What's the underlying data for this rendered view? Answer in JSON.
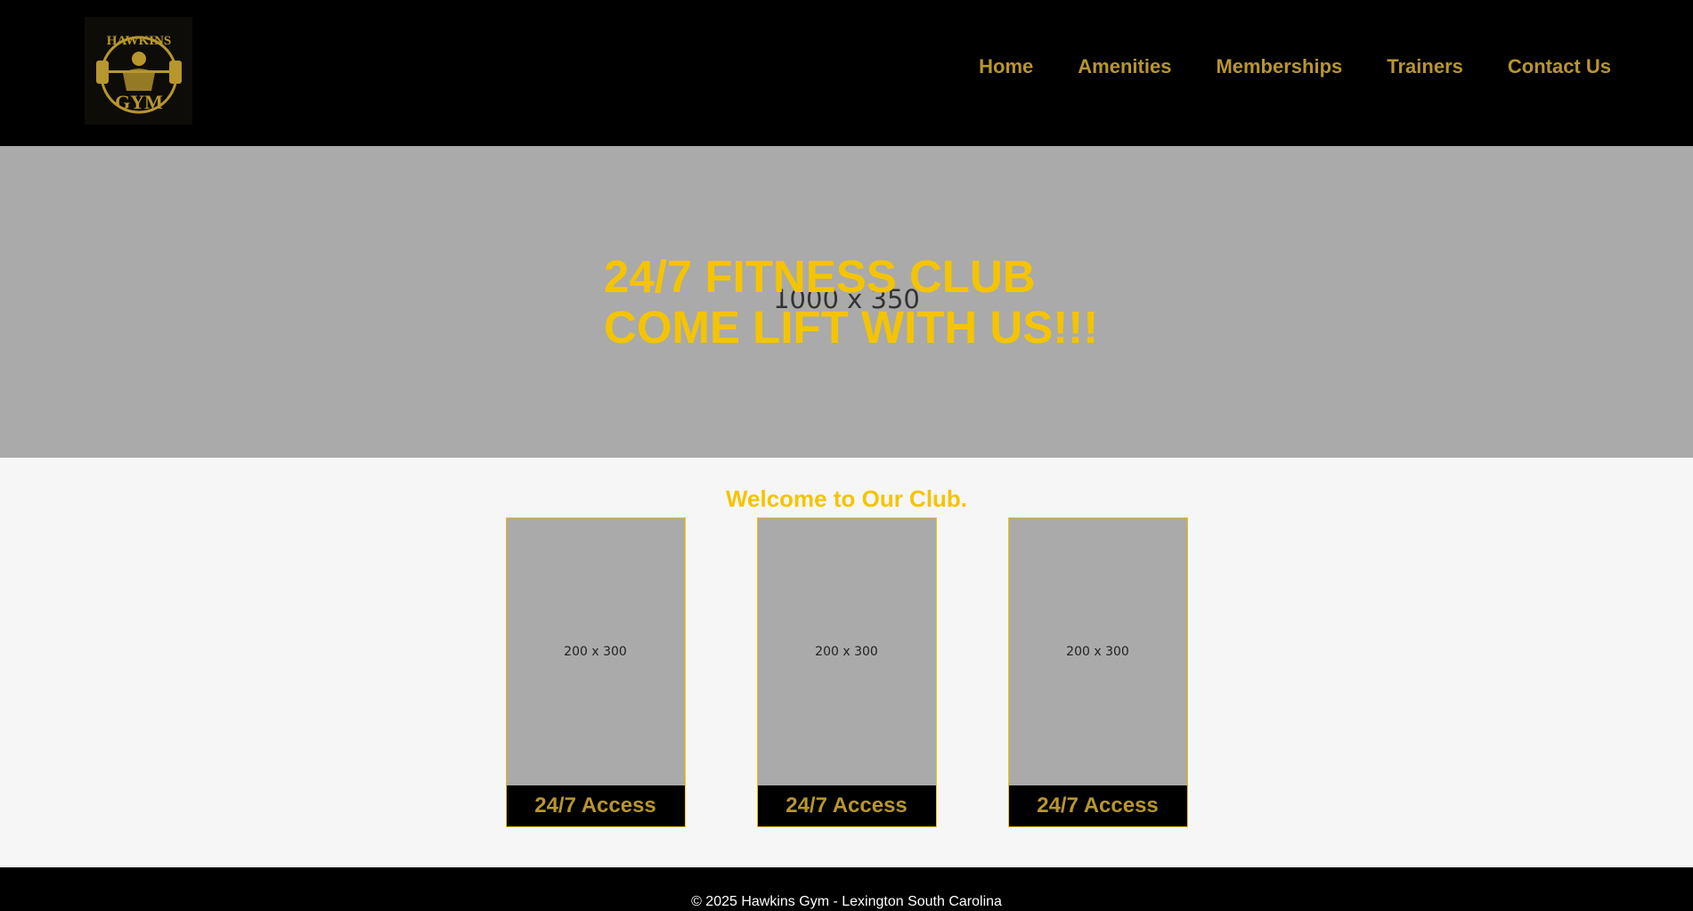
{
  "header": {
    "logo_text": "HAWKINS GYM",
    "nav": [
      "Home",
      "Amenities",
      "Memberships",
      "Trainers",
      "Contact Us"
    ]
  },
  "hero": {
    "placeholder": "1000 x 350",
    "line1": "24/7 FITNESS CLUB",
    "line2": "COME LIFT WITH US!!!"
  },
  "main": {
    "welcome": "Welcome to Our Club.",
    "cards": [
      {
        "placeholder": "200 x 300",
        "caption": "24/7 Access"
      },
      {
        "placeholder": "200 x 300",
        "caption": "24/7 Access"
      },
      {
        "placeholder": "200 x 300",
        "caption": "24/7 Access"
      }
    ]
  },
  "footer": {
    "text": "© 2025 Hawkins Gym - Lexington South Carolina"
  },
  "colors": {
    "accent": "#f5c400",
    "nav": "#b8962e"
  }
}
